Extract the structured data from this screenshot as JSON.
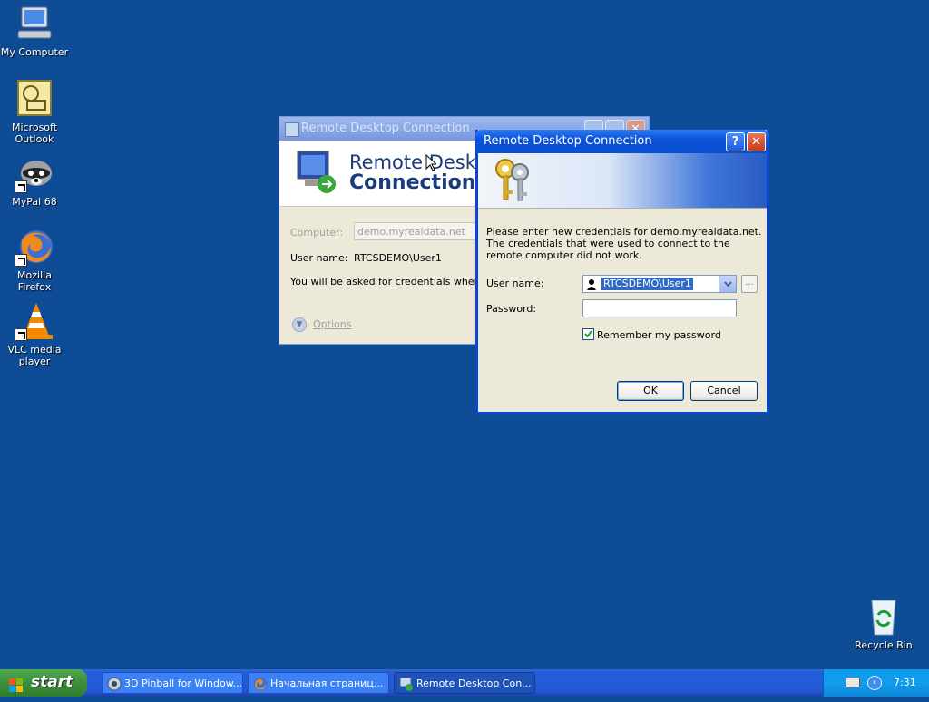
{
  "desktop": {
    "icons": [
      {
        "label": "My Computer"
      },
      {
        "label": "Microsoft Outlook"
      },
      {
        "label": "MyPal 68"
      },
      {
        "label": "Mozilla Firefox"
      },
      {
        "label": "VLC media player"
      },
      {
        "label": "Recycle Bin"
      }
    ]
  },
  "back_window": {
    "title": "Remote Desktop Connection",
    "banner_line1": "Remote Deskto",
    "banner_line2": "Connection",
    "computer_label": "Computer:",
    "computer_value": "demo.myrealdata.net",
    "username_label": "User name:",
    "username_value": "RTCSDEMO\\User1",
    "info_text": "You will be asked for credentials when you",
    "options_label": "Options"
  },
  "dialog": {
    "title": "Remote Desktop Connection",
    "help_glyph": "?",
    "close_glyph": "✕",
    "message": "Please enter new credentials for demo.myrealdata.net. The credentials that were used to connect to the remote computer did not work.",
    "username_label": "User name:",
    "username_value": "RTCSDEMO\\User1",
    "browse_label": "...",
    "password_label": "Password:",
    "password_value": "",
    "remember_label": "Remember my password",
    "remember_checked": true,
    "ok_label": "OK",
    "cancel_label": "Cancel"
  },
  "taskbar": {
    "start_label": "start",
    "tasks": [
      {
        "label": "3D Pinball for Window..."
      },
      {
        "label": "Начальная страниц..."
      },
      {
        "label": "Remote Desktop Con..."
      }
    ],
    "language": "EN",
    "clock": "7:31"
  },
  "colors": {
    "desktop": "#0e4c96",
    "title_active": "#0b53d9",
    "start_green": "#3c8f3c"
  }
}
